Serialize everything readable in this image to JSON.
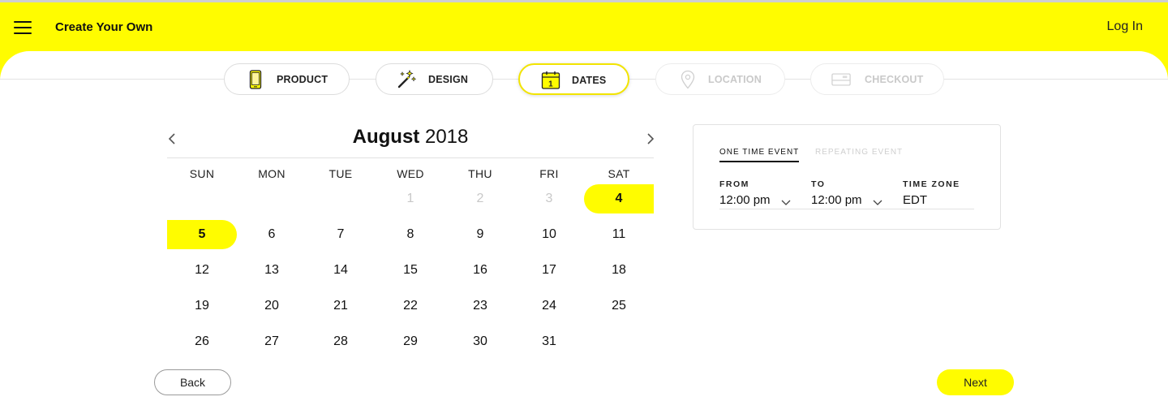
{
  "header": {
    "title": "Create Your Own",
    "login_label": "Log In",
    "menu_icon": "hamburger-menu-icon"
  },
  "steps": [
    {
      "label": "PRODUCT",
      "icon": "phone-icon",
      "state": "done"
    },
    {
      "label": "DESIGN",
      "icon": "magic-wand-icon",
      "state": "done"
    },
    {
      "label": "DATES",
      "icon": "calendar-icon",
      "state": "active"
    },
    {
      "label": "LOCATION",
      "icon": "location-pin-icon",
      "state": "disabled"
    },
    {
      "label": "CHECKOUT",
      "icon": "card-icon",
      "state": "disabled"
    }
  ],
  "calendar": {
    "month": "August",
    "year": "2018",
    "weekdays": [
      "SUN",
      "MON",
      "TUE",
      "WED",
      "THU",
      "FRI",
      "SAT"
    ],
    "days": [
      {
        "label": "1",
        "state": "muted"
      },
      {
        "label": "2",
        "state": "muted"
      },
      {
        "label": "3",
        "state": "muted"
      },
      {
        "label": "4",
        "state": "selected"
      },
      {
        "label": "5",
        "state": "selected"
      },
      {
        "label": "6"
      },
      {
        "label": "7"
      },
      {
        "label": "8"
      },
      {
        "label": "9"
      },
      {
        "label": "10"
      },
      {
        "label": "11"
      },
      {
        "label": "12"
      },
      {
        "label": "13"
      },
      {
        "label": "14"
      },
      {
        "label": "15"
      },
      {
        "label": "16"
      },
      {
        "label": "17"
      },
      {
        "label": "18"
      },
      {
        "label": "19"
      },
      {
        "label": "20"
      },
      {
        "label": "21"
      },
      {
        "label": "22"
      },
      {
        "label": "23"
      },
      {
        "label": "24"
      },
      {
        "label": "25"
      },
      {
        "label": "26"
      },
      {
        "label": "27"
      },
      {
        "label": "28"
      },
      {
        "label": "29"
      },
      {
        "label": "30"
      },
      {
        "label": "31"
      }
    ],
    "prev_icon": "chevron-left-icon",
    "next_icon": "chevron-right-icon"
  },
  "event_panel": {
    "tab_one_time": "ONE TIME EVENT",
    "tab_repeating": "REPEATING EVENT",
    "from_label": "FROM",
    "from_value": "12:00 pm",
    "to_label": "TO",
    "to_value": "12:00 pm",
    "timezone_label": "TIME ZONE",
    "timezone_value": "EDT"
  },
  "footer": {
    "back_label": "Back",
    "next_label": "Next"
  },
  "colors": {
    "accent": "#fffc00",
    "border": "#dcdcdc",
    "muted": "#c8c8c8"
  }
}
